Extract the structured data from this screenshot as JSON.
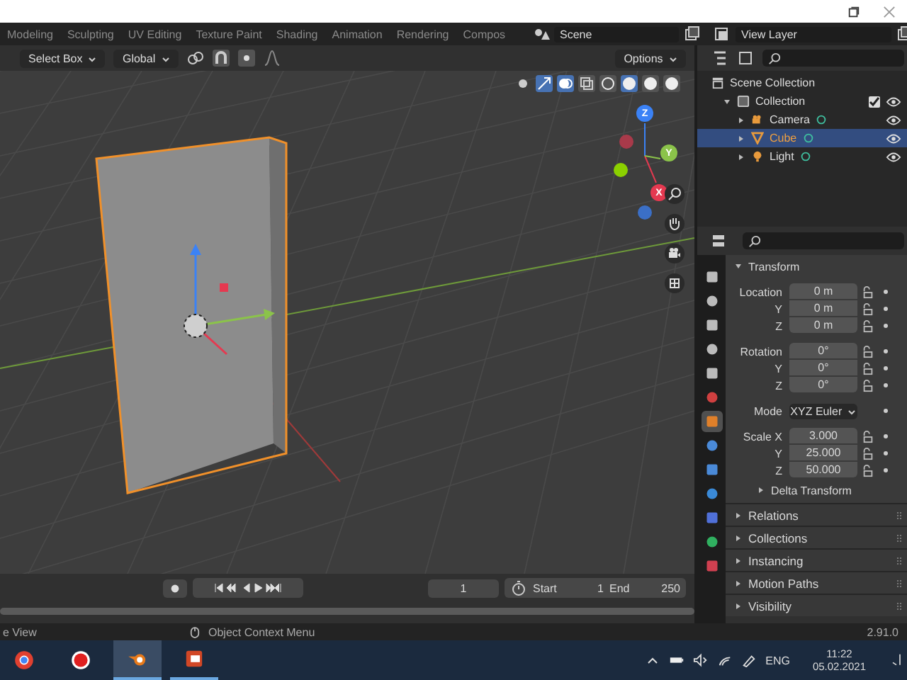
{
  "workspace_tabs": [
    {
      "label": "Modeling",
      "selected": false
    },
    {
      "label": "Sculpting",
      "selected": false
    },
    {
      "label": "UV Editing",
      "selected": false
    },
    {
      "label": "Texture Paint",
      "selected": false
    },
    {
      "label": "Shading",
      "selected": false
    },
    {
      "label": "Animation",
      "selected": false
    },
    {
      "label": "Rendering",
      "selected": false
    },
    {
      "label": "Compos",
      "selected": false
    }
  ],
  "scene": {
    "name": "Scene"
  },
  "view_layer": {
    "name": "View Layer"
  },
  "header": {
    "select_mode": "Select Box",
    "orientation": "Global",
    "options": "Options"
  },
  "shading_modes": [
    {
      "selected": false
    },
    {
      "selected": true
    },
    {
      "selected": false
    },
    {
      "selected": false
    }
  ],
  "gizmo_axes": [
    "Z",
    "Y",
    "X"
  ],
  "outliner": {
    "root": "Scene Collection",
    "collection": {
      "label": "Collection",
      "checked": true,
      "children": [
        {
          "label": "Camera",
          "selected": false
        },
        {
          "label": "Cube",
          "selected": true
        },
        {
          "label": "Light",
          "selected": false
        }
      ]
    }
  },
  "property_tabs": [
    {
      "selected": false
    },
    {
      "selected": false
    },
    {
      "selected": false
    },
    {
      "selected": false
    },
    {
      "selected": false
    },
    {
      "selected": false
    },
    {
      "selected": true
    },
    {
      "selected": false
    },
    {
      "selected": false
    },
    {
      "selected": false
    },
    {
      "selected": false
    },
    {
      "selected": false
    },
    {
      "selected": false
    }
  ],
  "transform": {
    "title": "Transform",
    "groups": [
      {
        "rows": [
          {
            "label": "Location",
            "value": "0 m",
            "kind": "field"
          },
          {
            "label": "Y",
            "value": "0 m",
            "kind": "field"
          },
          {
            "label": "Z",
            "value": "0 m",
            "kind": "field"
          }
        ]
      },
      {
        "rows": [
          {
            "label": "Rotation",
            "value": "0°",
            "kind": "field"
          },
          {
            "label": "Y",
            "value": "0°",
            "kind": "field"
          },
          {
            "label": "Z",
            "value": "0°",
            "kind": "field"
          }
        ]
      },
      {
        "rows": [
          {
            "label": "Mode",
            "value": "XYZ Euler",
            "kind": "dropdown"
          }
        ]
      },
      {
        "rows": [
          {
            "label": "Scale X",
            "value": "3.000",
            "kind": "field"
          },
          {
            "label": "Y",
            "value": "25.000",
            "kind": "field"
          },
          {
            "label": "Z",
            "value": "50.000",
            "kind": "field"
          }
        ]
      }
    ],
    "subpanel": "Delta Transform"
  },
  "panels": [
    "Relations",
    "Collections",
    "Instancing",
    "Motion Paths",
    "Visibility"
  ],
  "timeline": {
    "current_frame": "1",
    "start_label": "Start",
    "start": "1",
    "end_label": "End",
    "end": "250"
  },
  "status": {
    "left": "e View",
    "hint": "Object Context Menu",
    "version": "2.91.0"
  },
  "taskbar": {
    "apps": [
      {
        "active": false,
        "open": false
      },
      {
        "active": false,
        "open": false
      },
      {
        "active": true,
        "open": true
      },
      {
        "active": false,
        "open": true
      }
    ],
    "language": "ENG",
    "time": "11:22",
    "date": "05.02.2021"
  }
}
